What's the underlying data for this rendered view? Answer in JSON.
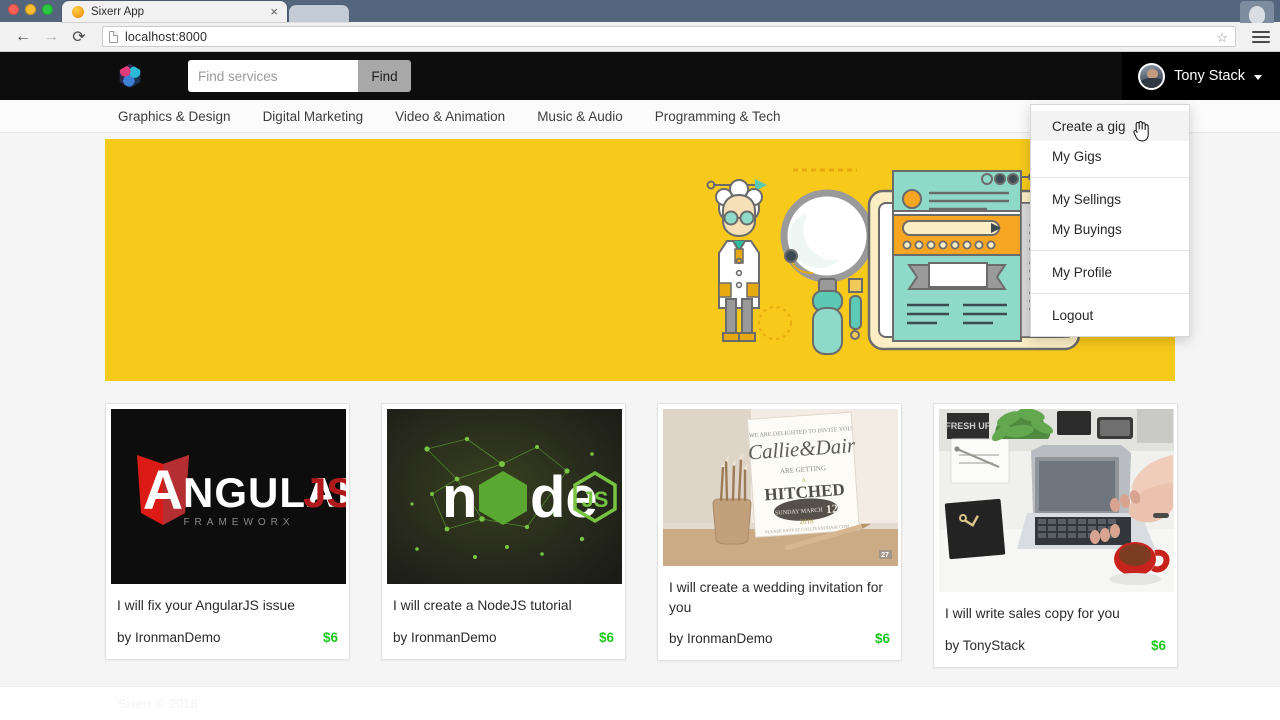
{
  "browser": {
    "tab_title": "Sixerr App",
    "tab_close_label": "×",
    "back_label": "←",
    "forward_label": "→",
    "reload_label": "⟳",
    "url": "localhost:8000",
    "star_label": "☆",
    "icons": {
      "favicon": "orange-circle-favicon",
      "page_doc": "page-document-icon",
      "bookmark": "star-icon",
      "menu": "hamburger-menu-icon"
    }
  },
  "header": {
    "logo_name": "sixerr-logo",
    "search": {
      "placeholder": "Find services",
      "value": "",
      "button_label": "Find"
    },
    "user": {
      "name": "Tony Stack",
      "avatar_name": "user-avatar",
      "caret": "chevron-down-icon"
    }
  },
  "categories": [
    {
      "label": "Graphics & Design"
    },
    {
      "label": "Digital Marketing"
    },
    {
      "label": "Video & Animation"
    },
    {
      "label": "Music & Audio"
    },
    {
      "label": "Programming & Tech"
    }
  ],
  "dropdown": {
    "open": true,
    "groups": [
      {
        "items": [
          {
            "label": "Create a gig",
            "hovered": true
          },
          {
            "label": "My Gigs",
            "hovered": false
          }
        ]
      },
      {
        "items": [
          {
            "label": "My Sellings",
            "hovered": false
          },
          {
            "label": "My Buyings",
            "hovered": false
          }
        ]
      },
      {
        "items": [
          {
            "label": "My Profile",
            "hovered": false
          }
        ]
      },
      {
        "items": [
          {
            "label": "Logout",
            "hovered": false
          }
        ]
      }
    ]
  },
  "banner": {
    "background_color": "#f7c91b",
    "illustration": "scientist-magnifier-browser-illustration"
  },
  "gigs": [
    {
      "title": "I will fix your AngularJS issue",
      "seller_prefix": "by ",
      "seller": "IronmanDemo",
      "price": "$6",
      "thumb": "angularjs-logo-thumbnail"
    },
    {
      "title": "I will create a NodeJS tutorial",
      "seller_prefix": "by ",
      "seller": "IronmanDemo",
      "price": "$6",
      "thumb": "nodejs-logo-thumbnail"
    },
    {
      "title": "I will create a wedding invitation for you",
      "seller_prefix": "by ",
      "seller": "IronmanDemo",
      "price": "$6",
      "thumb": "wedding-invitation-photo-thumbnail"
    },
    {
      "title": "I will write sales copy for you",
      "seller_prefix": "by ",
      "seller": "TonyStack",
      "price": "$6",
      "thumb": "laptop-desk-photo-thumbnail"
    }
  ],
  "footer": {
    "text": "Sixerr © 2018"
  },
  "colors": {
    "header_bg": "#0d0d0d",
    "banner_yellow": "#f7c91b",
    "price_green": "#1ec71e",
    "page_bg": "#f5f5f5"
  }
}
